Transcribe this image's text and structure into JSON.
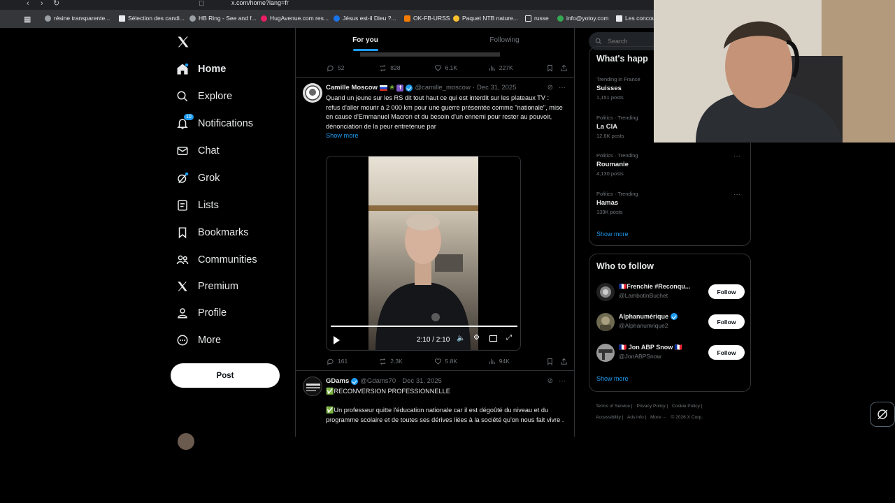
{
  "browser": {
    "url": "x.com/home?lang=fr",
    "bookmarks": [
      {
        "label": "résine transparente...",
        "color": "#9aa0a6"
      },
      {
        "label": "Sélection des candi...",
        "color": "#e8eaed"
      },
      {
        "label": "HB Ring - See and f...",
        "color": "#9aa0a6"
      },
      {
        "label": "HugAvenue.com res...",
        "color": "#e91e63"
      },
      {
        "label": "Jésus est-il Dieu ?...",
        "color": "#1a73e8"
      },
      {
        "label": "OK-FB-URSS",
        "color": "#f57c00"
      },
      {
        "label": "Paquet NTB nature...",
        "color": "#fbc02d"
      },
      {
        "label": "russe",
        "color": "#e8eaed"
      },
      {
        "label": "info@yotoy.com",
        "color": "#34a853"
      },
      {
        "label": "Les concou",
        "color": "#e8eaed"
      }
    ]
  },
  "nav": {
    "items": [
      {
        "label": "Home",
        "icon": "home-icon",
        "active": true
      },
      {
        "label": "Explore",
        "icon": "search-icon"
      },
      {
        "label": "Notifications",
        "icon": "bell-icon",
        "badge": "10"
      },
      {
        "label": "Chat",
        "icon": "mail-icon"
      },
      {
        "label": "Grok",
        "icon": "grok-icon"
      },
      {
        "label": "Lists",
        "icon": "list-icon"
      },
      {
        "label": "Bookmarks",
        "icon": "bookmark-icon"
      },
      {
        "label": "Communities",
        "icon": "communities-icon"
      },
      {
        "label": "Premium",
        "icon": "x-icon"
      },
      {
        "label": "Profile",
        "icon": "person-icon"
      },
      {
        "label": "More",
        "icon": "more-circle-icon"
      }
    ],
    "post_label": "Post"
  },
  "tabs": {
    "for_you": "For you",
    "following": "Following"
  },
  "top_actions": {
    "replies": "52",
    "reposts": "828",
    "likes": "6.1K",
    "views": "227K"
  },
  "tweet1": {
    "name": "Camille Moscow",
    "handle": "@camille_moscow",
    "date": "Dec 31, 2025",
    "text": "Quand un jeune sur les RS dit tout haut ce qui est interdit sur les plateaux TV :\nrefus d'aller mourir à 2 000 km pour une guerre présentée comme \"nationale\", mise en cause d'Emmanuel Macron et du besoin d'un ennemi pour rester au pouvoir, dénonciation de la peur entretenue par",
    "show_more": "Show more",
    "video_time": "2:10 / 2:10",
    "video_progress": 1.0,
    "replies": "161",
    "reposts": "2.3K",
    "likes": "5.8K",
    "views": "94K"
  },
  "tweet2": {
    "name": "GDams",
    "handle": "@Gdams70",
    "date": "Dec 31, 2025",
    "line1": "✅RECONVERSION PROFESSIONNELLE",
    "line2": "✅Un professeur quitte l'éducation nationale car il est dégoûté du niveau et du programme scolaire et de toutes ses dérives liées à la société qu'on nous fait vivre ."
  },
  "search": {
    "placeholder": "Search"
  },
  "trends": {
    "title": "What's happ",
    "items": [
      {
        "context": "Trending in France",
        "title": "Suisses",
        "count": "1,151 posts"
      },
      {
        "context": "Politics · Trending",
        "title": "La CIA",
        "count": "12.6K posts"
      },
      {
        "context": "Politics · Trending",
        "title": "Roumanie",
        "count": "4,130 posts"
      },
      {
        "context": "Politics · Trending",
        "title": "Hamas",
        "count": "139K posts"
      }
    ],
    "show_more": "Show more"
  },
  "who_to_follow": {
    "title": "Who to follow",
    "items": [
      {
        "name": "🇫🇷Frenchie #Reconqu...",
        "handle": "@LambotinBuchet",
        "verified": false
      },
      {
        "name": "Alphanumérique",
        "handle": "@Alphanumrique2",
        "verified": true
      },
      {
        "name": "🇫🇷 Jon ABP Snow 🇫🇷",
        "handle": "@JonABPSnow",
        "verified": false
      }
    ],
    "follow_label": "Follow",
    "show_more": "Show more"
  },
  "footer": [
    "Terms of Service |",
    "Privacy Policy |",
    "Cookie Policy |",
    "Accessibility |",
    "Ads info |",
    "More ···",
    "© 2026 X Corp."
  ],
  "colors": {
    "accent": "#1d9bf0",
    "background": "#000000",
    "muted": "#71767b"
  }
}
